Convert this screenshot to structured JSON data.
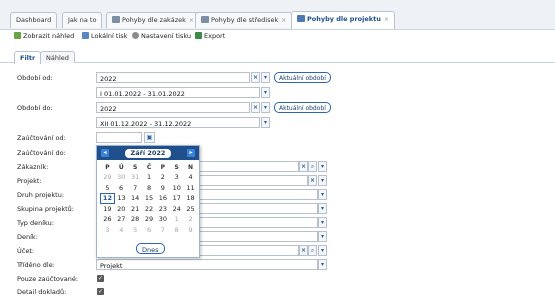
{
  "tabs": [
    {
      "label": "Dashboard",
      "active": false,
      "closable": false
    },
    {
      "label": "Jak na to",
      "active": false,
      "closable": false
    },
    {
      "label": "Pohyby dle zakázek",
      "active": false,
      "closable": true
    },
    {
      "label": "Pohyby dle středisek",
      "active": false,
      "closable": true
    },
    {
      "label": "Pohyby dle projektu",
      "active": true,
      "closable": true
    }
  ],
  "toolbar": {
    "preview": "Zobrazit náhled",
    "local_print": "Lokální tisk",
    "print_settings": "Nastavení tisku",
    "export": "Export"
  },
  "subtabs": {
    "filter": "Filtr",
    "preview": "Náhled"
  },
  "form": {
    "period_from_label": "Období od:",
    "period_from_year": "2022",
    "period_from_range": "I 01.01.2022 - 31.01.2022",
    "period_to_label": "Období do:",
    "period_to_year": "2022",
    "period_to_range": "XII 01.12.2022 - 31.12.2022",
    "current_period": "Aktuální období",
    "posting_from_label": "Zaúčtování od:",
    "posting_to_label": "Zaúčtování do:",
    "customer_label": "Zákazník:",
    "project_label": "Projekt:",
    "project_type_label": "Druh projektu:",
    "project_group_label": "Skupina projektů:",
    "journal_type_label": "Typ deníku:",
    "journal_label": "Deník:",
    "account_label": "Účet:",
    "sort_label": "Tříděno dle:",
    "sort_value": "Projekt",
    "posted_only_label": "Pouze zaúčtované:",
    "doc_detail_label": "Detail dokladů:"
  },
  "calendar": {
    "month": "Září 2022",
    "weekdays": [
      "P",
      "Ú",
      "S",
      "Č",
      "P",
      "S",
      "N"
    ],
    "weeks": [
      [
        "29",
        "30",
        "31",
        "1",
        "2",
        "3",
        "4"
      ],
      [
        "5",
        "6",
        "7",
        "8",
        "9",
        "10",
        "11"
      ],
      [
        "12",
        "13",
        "14",
        "15",
        "16",
        "17",
        "18"
      ],
      [
        "19",
        "20",
        "21",
        "22",
        "23",
        "24",
        "25"
      ],
      [
        "26",
        "27",
        "28",
        "29",
        "30",
        "1",
        "2"
      ],
      [
        "3",
        "4",
        "5",
        "6",
        "7",
        "8",
        "9"
      ]
    ],
    "today_label": "Dnes",
    "selected_day": "12"
  },
  "colors": {
    "accent": "#1f4f8c",
    "link": "#2b67b0"
  }
}
